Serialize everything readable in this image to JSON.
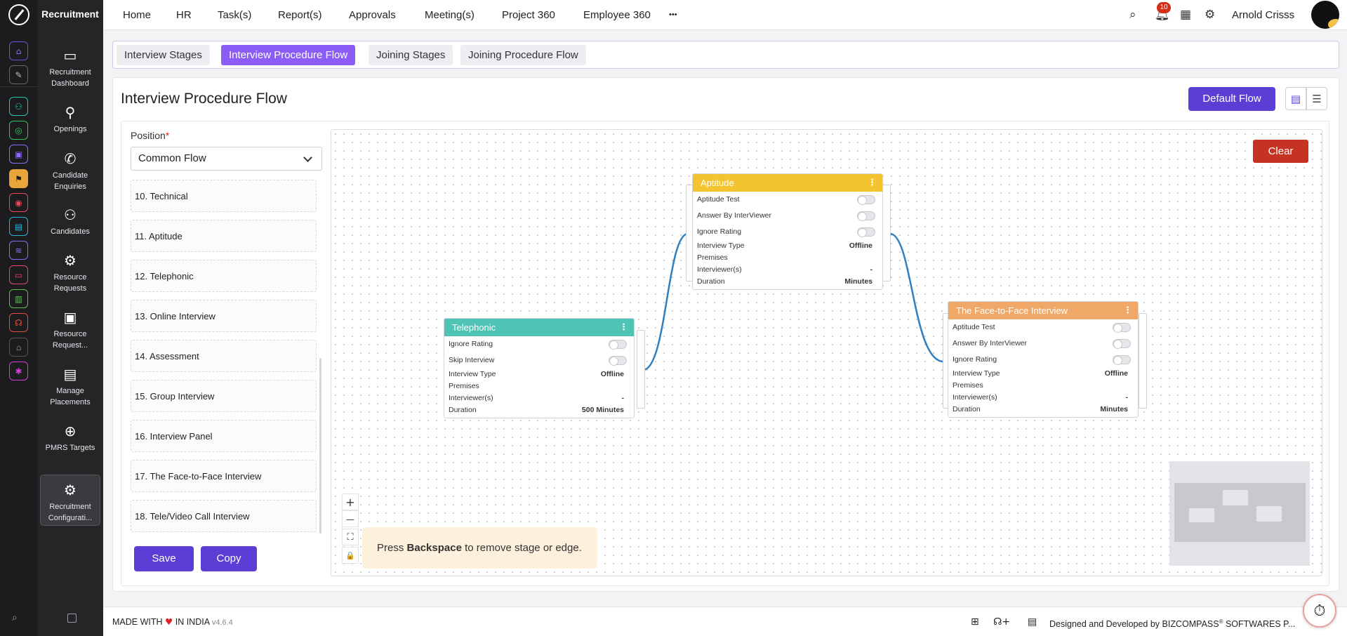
{
  "app": {
    "title": "Recruitment"
  },
  "nav": {
    "items": [
      "Home",
      "HR",
      "Task(s)",
      "Report(s)",
      "Approvals",
      "Meeting(s)",
      "Project 360",
      "Employee 360"
    ],
    "more": "•••"
  },
  "header": {
    "notification_count": "10",
    "user_name": "Arnold Crisss"
  },
  "sidebar": {
    "items": [
      {
        "label": "Recruitment Dashboard",
        "icon": "monitor-icon"
      },
      {
        "label": "Openings",
        "icon": "user-search-icon"
      },
      {
        "label": "Candidate Enquiries",
        "icon": "phone-icon"
      },
      {
        "label": "Candidates",
        "icon": "users-icon"
      },
      {
        "label": "Resource Requests",
        "icon": "user-settings-icon"
      },
      {
        "label": "Resource Request...",
        "icon": "id-card-icon"
      },
      {
        "label": "Manage Placements",
        "icon": "browser-search-icon"
      },
      {
        "label": "PMRS Targets",
        "icon": "plus-circle-icon"
      },
      {
        "label": "Recruitment Configurati...",
        "icon": "gear-icon"
      }
    ]
  },
  "subtabs": [
    "Interview Stages",
    "Interview Procedure Flow",
    "Joining Stages",
    "Joining Procedure Flow"
  ],
  "page": {
    "title": "Interview Procedure Flow",
    "default_flow_label": "Default Flow"
  },
  "form": {
    "position_label": "Position",
    "required_mark": "*",
    "position_value": "Common Flow",
    "stages": [
      "10. Technical",
      "11. Aptitude",
      "12. Telephonic",
      "13. Online Interview",
      "14. Assessment",
      "15. Group Interview",
      "16. Interview Panel",
      "17. The Face-to-Face Interview",
      "18. Tele/Video Call Interview"
    ],
    "save_label": "Save",
    "copy_label": "Copy"
  },
  "canvas": {
    "clear_label": "Clear",
    "hint_prefix": "Press",
    "hint_key": "Backspace",
    "hint_suffix": "to remove stage or edge.",
    "controls": [
      "+",
      "—",
      "⛶",
      "🔒"
    ]
  },
  "nodes": {
    "aptitude": {
      "title": "Aptitude",
      "color": "#f4c430",
      "toggles": [
        "Aptitude Test",
        "Answer By InterViewer",
        "Ignore Rating"
      ],
      "fields": [
        {
          "label": "Interview Type",
          "value": "Offline"
        },
        {
          "label": "Premises",
          "value": ""
        },
        {
          "label": "Interviewer(s)",
          "value": "-"
        },
        {
          "label": "Duration",
          "value": "Minutes"
        }
      ]
    },
    "telephonic": {
      "title": "Telephonic",
      "color": "#4fc3b4",
      "toggles": [
        "Ignore Rating",
        "Skip Interview"
      ],
      "fields": [
        {
          "label": "Interview Type",
          "value": "Offline"
        },
        {
          "label": "Premises",
          "value": ""
        },
        {
          "label": "Interviewer(s)",
          "value": "-"
        },
        {
          "label": "Duration",
          "value": "500 Minutes"
        }
      ]
    },
    "face": {
      "title": "The Face-to-Face Interview",
      "color": "#f0a868",
      "toggles": [
        "Aptitude Test",
        "Answer By InterViewer",
        "Ignore Rating"
      ],
      "fields": [
        {
          "label": "Interview Type",
          "value": "Offline"
        },
        {
          "label": "Premises",
          "value": ""
        },
        {
          "label": "Interviewer(s)",
          "value": "-"
        },
        {
          "label": "Duration",
          "value": "Minutes"
        }
      ]
    }
  },
  "footer": {
    "made_with": "MADE WITH",
    "heart": "♥",
    "in_india": "IN INDIA",
    "version": "v4.6.4",
    "designed_by": "Designed and Developed by",
    "company": "BIZCOMPASS",
    "reg": "®",
    "company_suffix": "SOFTWARES P..."
  },
  "colors": {
    "primary": "#5b3fd4",
    "tab_active": "#8b5cf6",
    "danger": "#c73322",
    "edge": "#2f7fc1"
  }
}
